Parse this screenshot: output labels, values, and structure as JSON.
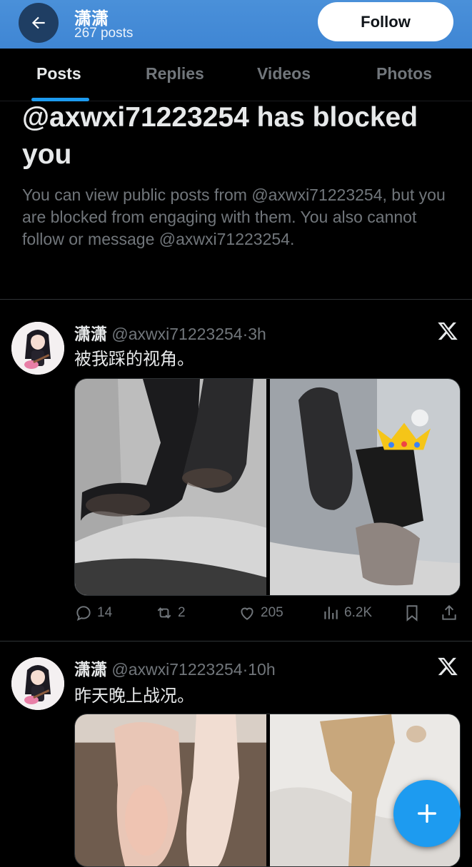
{
  "header": {
    "name": "潇潇",
    "post_count": "267 posts",
    "follow_label": "Follow"
  },
  "tabs": [
    {
      "label": "Posts",
      "active": true
    },
    {
      "label": "Replies",
      "active": false
    },
    {
      "label": "Videos",
      "active": false
    },
    {
      "label": "Photos",
      "active": false
    }
  ],
  "blocked": {
    "title": "@axwxi71223254 has blocked you",
    "body": "You can view public posts from @axwxi71223254, but you are blocked from engaging with them. You also cannot follow or message @axwxi71223254."
  },
  "posts": [
    {
      "name": "潇潇",
      "handle": "@axwxi71223254",
      "separator": "·",
      "time": "3h",
      "text": "被我踩的视角。",
      "replies": "14",
      "reposts": "2",
      "likes": "205",
      "views": "6.2K"
    },
    {
      "name": "潇潇",
      "handle": "@axwxi71223254",
      "separator": "·",
      "time": "10h",
      "text": "昨天晚上战况。"
    }
  ],
  "icons": {
    "back": "arrow-left-icon",
    "platform": "x-logo-icon",
    "reply": "reply-icon",
    "repost": "repost-icon",
    "like": "heart-icon",
    "views": "views-icon",
    "bookmark": "bookmark-icon",
    "share": "share-icon",
    "compose": "plus-icon"
  },
  "colors": {
    "header_bg": "#3f86d4",
    "accent": "#1d9bf0",
    "background": "#000000",
    "muted_text": "#71767b"
  }
}
